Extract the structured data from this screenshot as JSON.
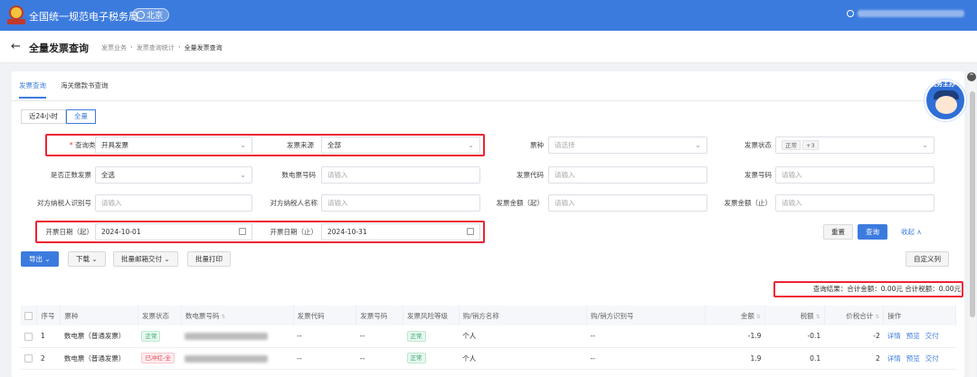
{
  "app": {
    "title": "全国统一规范电子税务局",
    "city": "北京"
  },
  "header": {
    "back": "←",
    "page_title": "全量发票查询",
    "breadcrumb": [
      "发票业务",
      "发票查询统计",
      "全量发票查询"
    ],
    "breadcrumb_sep": "›"
  },
  "tabs": [
    "发票查询",
    "海关缴款书查询"
  ],
  "time_range": [
    "近24小时",
    "全量"
  ],
  "filters": {
    "query_type": {
      "label": "查询类型",
      "value": "开具发票"
    },
    "invoice_source": {
      "label": "发票来源",
      "value": "全部"
    },
    "invoice_kind": {
      "label": "票种",
      "placeholder": "请选择"
    },
    "invoice_status": {
      "label": "发票状态",
      "tag": "正常",
      "more": "+3"
    },
    "is_positive": {
      "label": "是否正数发票",
      "value": "全选"
    },
    "einvoice_no": {
      "label": "数电票号码",
      "placeholder": "请输入"
    },
    "invoice_code": {
      "label": "发票代码",
      "placeholder": "请输入"
    },
    "invoice_no": {
      "label": "发票号码",
      "placeholder": "请输入"
    },
    "counterparty_tax_id": {
      "label": "对方纳税人识别号",
      "placeholder": "请输入"
    },
    "counterparty_name": {
      "label": "对方纳税人名称",
      "placeholder": "请输入"
    },
    "amount_from": {
      "label": "发票金额（起）",
      "placeholder": "请输入"
    },
    "amount_to": {
      "label": "发票金额（止）",
      "placeholder": "请输入"
    },
    "date_from": {
      "label": "开票日期（起）",
      "value": "2024-10-01"
    },
    "date_to": {
      "label": "开票日期（止）",
      "value": "2024-10-31"
    }
  },
  "actions": {
    "reset": "重置",
    "query": "查询",
    "collapse": "收起 ∧",
    "export": "导出",
    "download": "下载",
    "batch_email": "批量邮箱交付",
    "batch_print": "批量打印",
    "custom_columns": "自定义列"
  },
  "summary": "查询结果：合计金额：0.00元   合计税额：0.00元",
  "table": {
    "columns": [
      "序号",
      "票种",
      "发票状态",
      "数电票号码",
      "发票代码",
      "发票号码",
      "发票风险等级",
      "购/销方名称",
      "购/销方识别号",
      "金额",
      "税额",
      "价税合计",
      "操作"
    ],
    "rows": [
      {
        "idx": "1",
        "kind": "数电票（普通发票）",
        "status": "正常",
        "status_color": "green",
        "code": "--",
        "no": "--",
        "risk": "正常",
        "name": "个人",
        "taxid": "--",
        "amount": "-1.9",
        "tax": "-0.1",
        "total": "-2"
      },
      {
        "idx": "2",
        "kind": "数电票（普通发票）",
        "status": "已冲红-全",
        "status_color": "red",
        "code": "--",
        "no": "--",
        "risk": "正常",
        "name": "个人",
        "taxid": "--",
        "amount": "1.9",
        "tax": "0.1",
        "total": "2"
      }
    ],
    "ops": [
      "详情",
      "预览",
      "交付"
    ]
  },
  "assistant": {
    "label": "税务主办"
  },
  "colors": {
    "brand": "#3c7bde",
    "highlight": "#e22233"
  }
}
